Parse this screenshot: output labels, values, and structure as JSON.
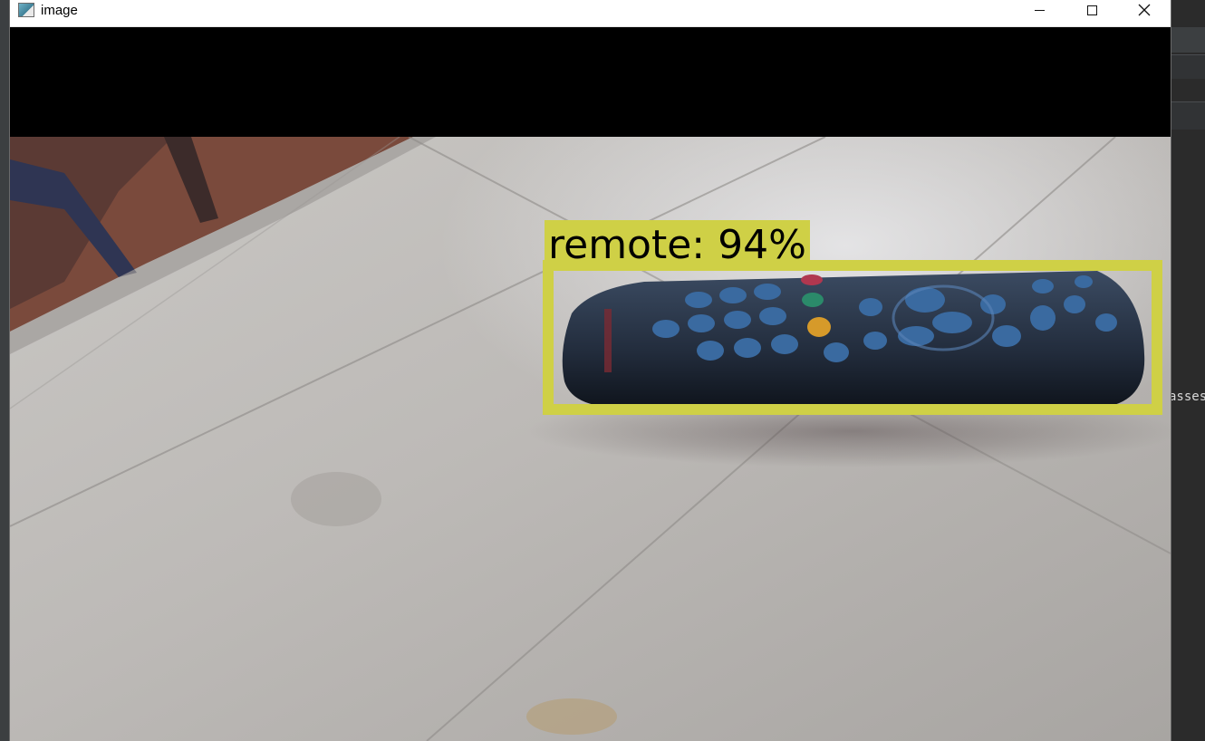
{
  "window": {
    "title": "image",
    "icon": "image-window-icon",
    "controls": {
      "minimize": "minimize-icon",
      "maximize": "maximize-icon",
      "close": "close-icon"
    }
  },
  "detection": {
    "label": "remote: 94%",
    "class": "remote",
    "confidence": 0.94,
    "box_color": "#cfd046"
  },
  "background_app": {
    "visible_text": "asses"
  }
}
